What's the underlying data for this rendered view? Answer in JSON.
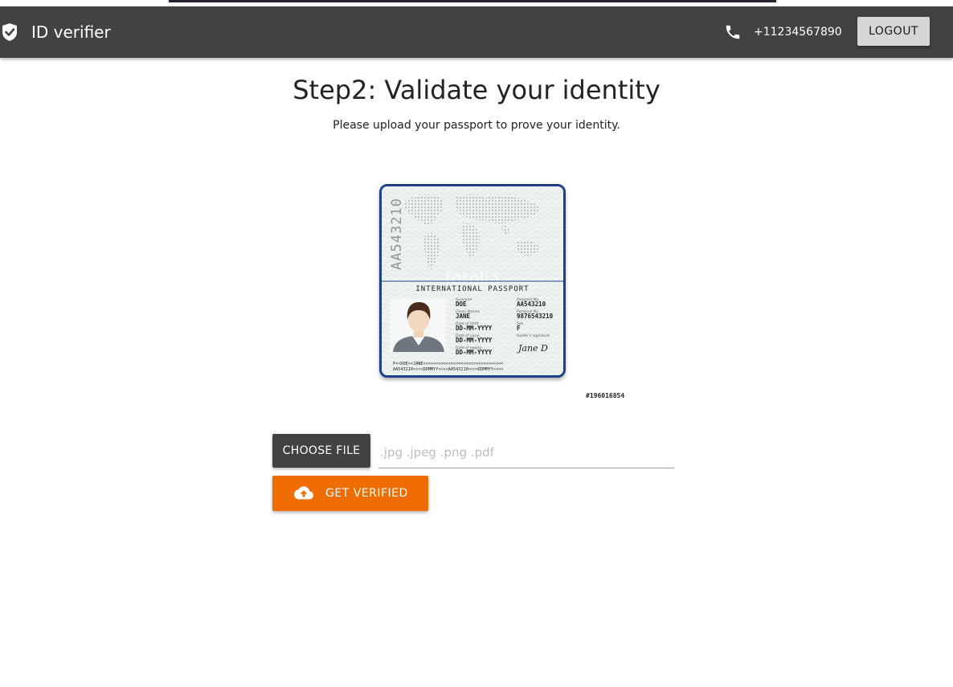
{
  "appbar": {
    "brand_icon": "shield-check-icon",
    "title": "ID verifier",
    "phone_icon": "phone-icon",
    "phone": "+11234567890",
    "logout_label": "LOGOUT"
  },
  "main": {
    "title": "Step2: Validate your identity",
    "subtitle": "Please upload your passport to prove your identity."
  },
  "passport_image": {
    "watermark": "fotolia",
    "header": "INTERNATIONAL PASSPORT",
    "side_number": "AA543210",
    "fields": {
      "surname_label": "Surname",
      "surname": "DOE",
      "given_names_label": "Given Names",
      "given_names": "JANE",
      "dob_label": "Date of birth",
      "dob": "DD-MM-YYYY",
      "issue_label": "Date of issue",
      "issue": "DD-MM-YYYY",
      "expiry_label": "Date of expiry",
      "expiry": "DD-MM-YYYY",
      "passport_no_label": "Passport No.",
      "passport_no": "AA543210",
      "personal_no_label": "Personal No.",
      "personal_no": "9876543210",
      "sex_label": "Sex",
      "sex": "F",
      "signature_label": "Holder's signature",
      "signature": "Jane D"
    },
    "mrz_line1": "P<<DOE<<JANE<<<<<<<<<<<<<<<<<<<<<<<<<<<<<<<<",
    "mrz_line2": "AA543210<<<<DDMMYY<<<<AA543210<<<<DDMMYY<<<<",
    "image_id": "#196016854"
  },
  "upload": {
    "choose_label": "CHOOSE FILE",
    "file_placeholder": ".jpg .jpeg .png .pdf",
    "submit_label": "GET VERIFIED",
    "submit_icon": "cloud-upload-icon"
  },
  "colors": {
    "appbar": "#424242",
    "accent": "#ef6c00",
    "passport_border": "#1f3f8c"
  }
}
